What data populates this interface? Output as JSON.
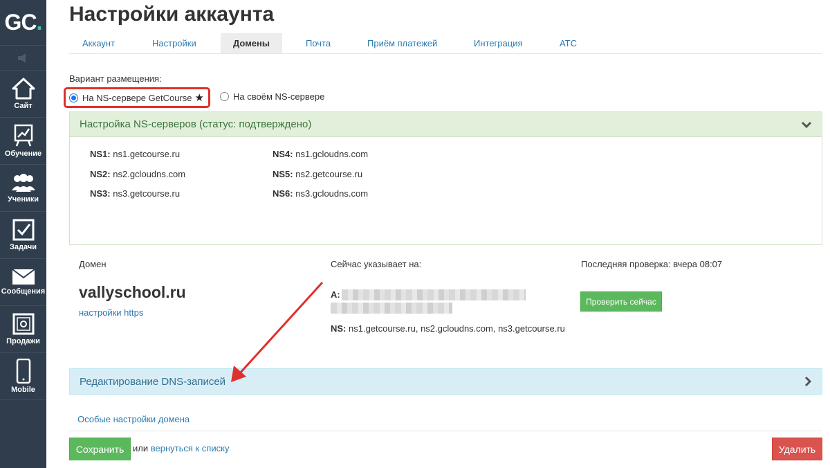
{
  "sidebar": {
    "logo": {
      "text": "GC",
      "dot": "."
    },
    "items": [
      {
        "label": "Сайт",
        "icon": "home-icon"
      },
      {
        "label": "Обучение",
        "icon": "chart-board-icon"
      },
      {
        "label": "Ученики",
        "icon": "users-icon"
      },
      {
        "label": "Задачи",
        "icon": "checkbox-icon"
      },
      {
        "label": "Сообщения",
        "icon": "envelope-icon"
      },
      {
        "label": "Продажи",
        "icon": "safe-icon"
      },
      {
        "label": "Mobile",
        "icon": "phone-icon"
      }
    ]
  },
  "page": {
    "title": "Настройки аккаунта"
  },
  "tabs": [
    {
      "label": "Аккаунт",
      "active": false
    },
    {
      "label": "Настройки",
      "active": false
    },
    {
      "label": "Домены",
      "active": true
    },
    {
      "label": "Почта",
      "active": false
    },
    {
      "label": "Приём платежей",
      "active": false
    },
    {
      "label": "Интеграция",
      "active": false
    },
    {
      "label": "АТС",
      "active": false
    }
  ],
  "placement": {
    "label": "Вариант размещения:",
    "options": [
      {
        "label": "На NS-сервере GetCourse",
        "selected": true,
        "star": "★"
      },
      {
        "label": "На своём NS-сервере",
        "selected": false
      }
    ]
  },
  "ns_panel": {
    "title": "Настройка NS-серверов (статус: подтверждено)",
    "servers": [
      {
        "key": "NS1:",
        "value": "ns1.getcourse.ru"
      },
      {
        "key": "NS2:",
        "value": "ns2.gcloudns.com"
      },
      {
        "key": "NS3:",
        "value": "ns3.getcourse.ru"
      },
      {
        "key": "NS4:",
        "value": "ns1.gcloudns.com"
      },
      {
        "key": "NS5:",
        "value": "ns2.getcourse.ru"
      },
      {
        "key": "NS6:",
        "value": "ns3.gcloudns.com"
      }
    ]
  },
  "domain": {
    "domain_label": "Домен",
    "name": "vallyschool.ru",
    "https_link": "настройки https",
    "points_label": "Сейчас указывает на:",
    "a_label": "A:",
    "ns_label": "NS:",
    "ns_value": "ns1.getcourse.ru, ns2.gcloudns.com, ns3.getcourse.ru",
    "last_check": "Последняя проверка: вчера 08:07",
    "check_button": "Проверить сейчас"
  },
  "dns_panel": {
    "title": "Редактирование DNS-записей"
  },
  "special_settings_link": "Особые настройки домена",
  "footer": {
    "save": "Сохранить",
    "or": "или",
    "back_link": "вернуться к списку",
    "delete": "Удалить"
  },
  "colors": {
    "sidebar": "#2f3d4c",
    "link": "#2a7ab0",
    "success": "#5cb85c",
    "danger": "#d9534f",
    "highlight": "#e0302c",
    "ns_panel_bg": "#e2efdb",
    "dns_panel_bg": "#d9edf7"
  }
}
